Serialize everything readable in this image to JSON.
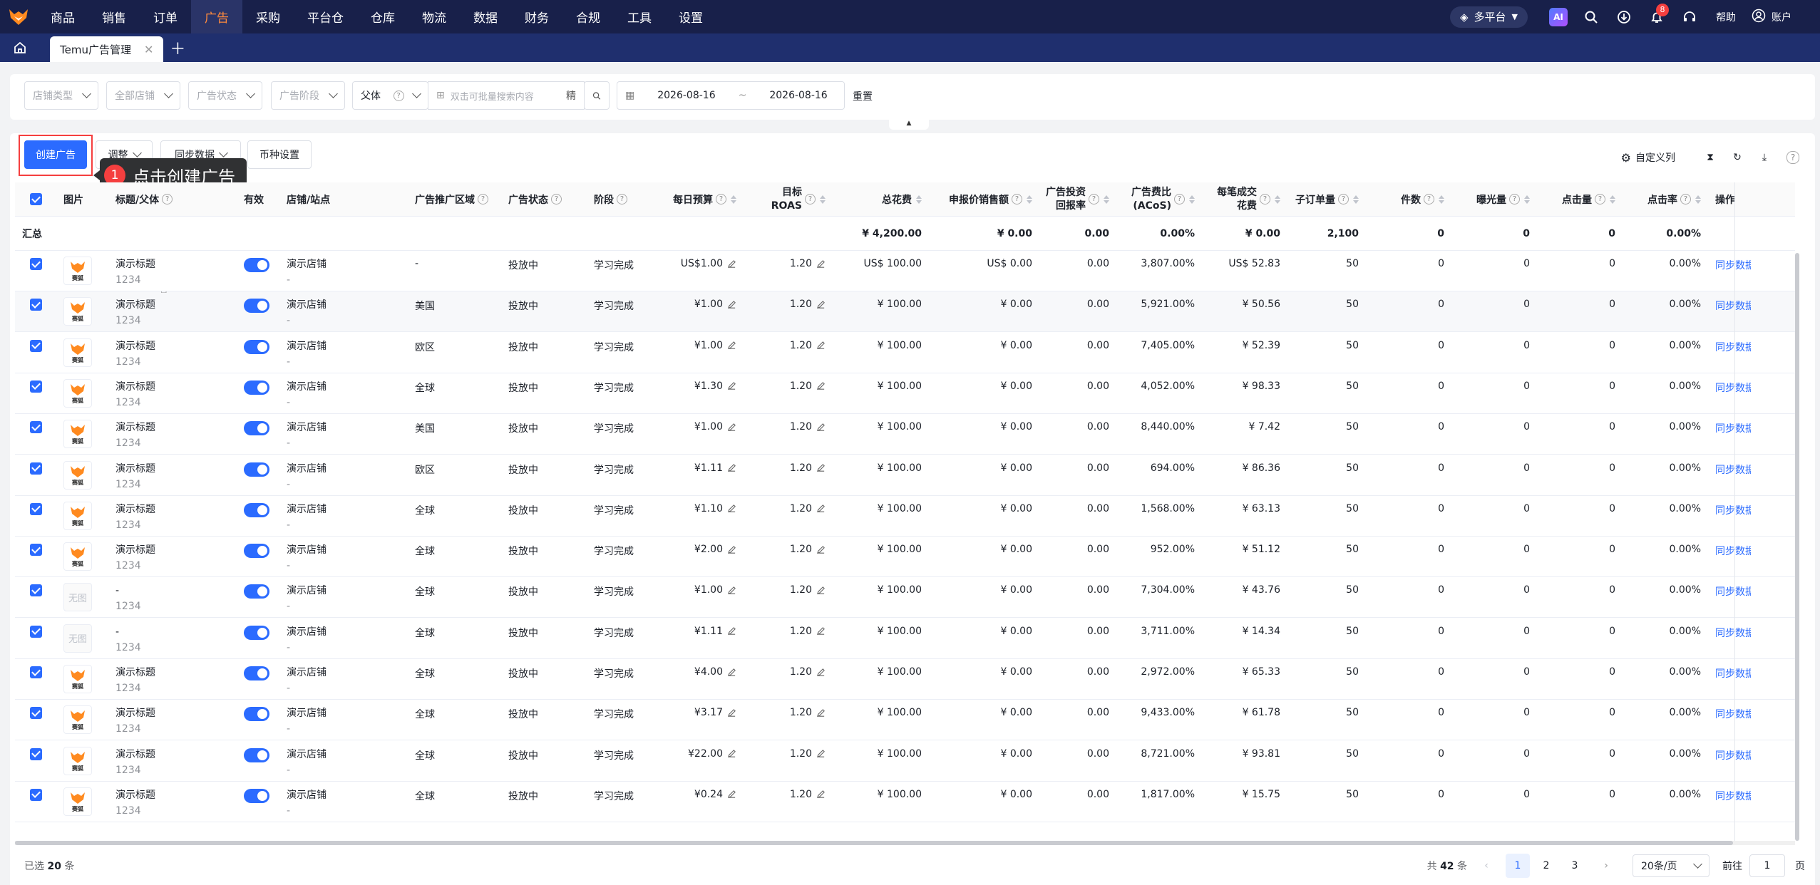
{
  "nav": {
    "items": [
      "商品",
      "销售",
      "订单",
      "广告",
      "采购",
      "平台仓",
      "仓库",
      "物流",
      "数据",
      "财务",
      "合规",
      "工具",
      "设置"
    ],
    "active_index": 3,
    "platform": "多平台",
    "notifications": "8",
    "help": "帮助",
    "account": "账户"
  },
  "tabs": {
    "current": "Temu广告管理"
  },
  "filters": {
    "shop_type": "店铺类型",
    "all_shops": "全部店铺",
    "ad_status": "广告状态",
    "ad_stage": "广告阶段",
    "parent": "父体",
    "search_placeholder": "双击可批量搜索内容",
    "exact": "精",
    "date_start": "2026-08-16",
    "date_sep": "~",
    "date_end": "2026-08-16",
    "reset": "重置"
  },
  "toolbar": {
    "create": "创建广告",
    "adjust": "调整",
    "sync": "同步数据",
    "currency": "币种设置",
    "custom_cols": "自定义列"
  },
  "tooltip": {
    "step": "1",
    "text": "点击创建广告"
  },
  "table": {
    "headers": {
      "image": "图片",
      "title": "标题/父体",
      "valid": "有效",
      "shop": "店铺/站点",
      "region": "广告推广区域",
      "status": "广告状态",
      "stage": "阶段",
      "budget": "每日预算",
      "roas_1": "目标",
      "roas_2": "ROAS",
      "spend": "总花费",
      "declared_sales": "申报价销售额",
      "roi_1": "广告投资",
      "roi_2": "回报率",
      "acos_1": "广告费比",
      "acos_2": "(ACoS)",
      "cpa_1": "每笔成交",
      "cpa_2": "花费",
      "sub_orders": "子订单量",
      "pieces": "件数",
      "impressions": "曝光量",
      "clicks": "点击量",
      "ctr": "点击率",
      "ops": "操作"
    },
    "summary": {
      "label": "汇总",
      "spend": "¥ 4,200.00",
      "sales": "¥ 0.00",
      "roi": "0.00",
      "acos": "0.00%",
      "cpa": "¥ 0.00",
      "sub_orders": "2,100",
      "pieces": "0",
      "impressions": "0",
      "clicks": "0",
      "ctr": "0.00%"
    },
    "rows": [
      {
        "img": "logo",
        "title": "演示标题",
        "sku": "1234",
        "shop": "演示店铺",
        "site": "-",
        "region": "-",
        "status": "投放中",
        "stage": "学习完成",
        "budget": "US$1.00",
        "roas": "1.20",
        "spend": "US$ 100.00",
        "sales": "US$ 0.00",
        "roi": "0.00",
        "acos": "3,807.00%",
        "cpa": "US$ 52.83",
        "sub_orders": "50",
        "pieces": "0",
        "impressions": "0",
        "clicks": "0",
        "ctr": "0.00%",
        "op": "同步数据"
      },
      {
        "img": "logo",
        "title": "演示标题",
        "sku": "1234",
        "shop": "演示店铺",
        "site": "-",
        "region": "美国",
        "status": "投放中",
        "stage": "学习完成",
        "budget": "¥1.00",
        "roas": "1.20",
        "spend": "¥ 100.00",
        "sales": "¥ 0.00",
        "roi": "0.00",
        "acos": "5,921.00%",
        "cpa": "¥ 50.56",
        "sub_orders": "50",
        "pieces": "0",
        "impressions": "0",
        "clicks": "0",
        "ctr": "0.00%",
        "op": "同步数据"
      },
      {
        "img": "logo",
        "title": "演示标题",
        "sku": "1234",
        "shop": "演示店铺",
        "site": "-",
        "region": "欧区",
        "status": "投放中",
        "stage": "学习完成",
        "budget": "¥1.00",
        "roas": "1.20",
        "spend": "¥ 100.00",
        "sales": "¥ 0.00",
        "roi": "0.00",
        "acos": "7,405.00%",
        "cpa": "¥ 52.39",
        "sub_orders": "50",
        "pieces": "0",
        "impressions": "0",
        "clicks": "0",
        "ctr": "0.00%",
        "op": "同步数据"
      },
      {
        "img": "logo",
        "title": "演示标题",
        "sku": "1234",
        "shop": "演示店铺",
        "site": "-",
        "region": "全球",
        "status": "投放中",
        "stage": "学习完成",
        "budget": "¥1.30",
        "roas": "1.20",
        "spend": "¥ 100.00",
        "sales": "¥ 0.00",
        "roi": "0.00",
        "acos": "4,052.00%",
        "cpa": "¥ 98.33",
        "sub_orders": "50",
        "pieces": "0",
        "impressions": "0",
        "clicks": "0",
        "ctr": "0.00%",
        "op": "同步数据"
      },
      {
        "img": "logo",
        "title": "演示标题",
        "sku": "1234",
        "shop": "演示店铺",
        "site": "-",
        "region": "美国",
        "status": "投放中",
        "stage": "学习完成",
        "budget": "¥1.00",
        "roas": "1.20",
        "spend": "¥ 100.00",
        "sales": "¥ 0.00",
        "roi": "0.00",
        "acos": "8,440.00%",
        "cpa": "¥ 7.42",
        "sub_orders": "50",
        "pieces": "0",
        "impressions": "0",
        "clicks": "0",
        "ctr": "0.00%",
        "op": "同步数据"
      },
      {
        "img": "logo",
        "title": "演示标题",
        "sku": "1234",
        "shop": "演示店铺",
        "site": "-",
        "region": "欧区",
        "status": "投放中",
        "stage": "学习完成",
        "budget": "¥1.11",
        "roas": "1.20",
        "spend": "¥ 100.00",
        "sales": "¥ 0.00",
        "roi": "0.00",
        "acos": "694.00%",
        "cpa": "¥ 86.36",
        "sub_orders": "50",
        "pieces": "0",
        "impressions": "0",
        "clicks": "0",
        "ctr": "0.00%",
        "op": "同步数据"
      },
      {
        "img": "logo",
        "title": "演示标题",
        "sku": "1234",
        "shop": "演示店铺",
        "site": "-",
        "region": "全球",
        "status": "投放中",
        "stage": "学习完成",
        "budget": "¥1.10",
        "roas": "1.20",
        "spend": "¥ 100.00",
        "sales": "¥ 0.00",
        "roi": "0.00",
        "acos": "1,568.00%",
        "cpa": "¥ 63.13",
        "sub_orders": "50",
        "pieces": "0",
        "impressions": "0",
        "clicks": "0",
        "ctr": "0.00%",
        "op": "同步数据"
      },
      {
        "img": "logo",
        "title": "演示标题",
        "sku": "1234",
        "shop": "演示店铺",
        "site": "-",
        "region": "全球",
        "status": "投放中",
        "stage": "学习完成",
        "budget": "¥2.00",
        "roas": "1.20",
        "spend": "¥ 100.00",
        "sales": "¥ 0.00",
        "roi": "0.00",
        "acos": "952.00%",
        "cpa": "¥ 51.12",
        "sub_orders": "50",
        "pieces": "0",
        "impressions": "0",
        "clicks": "0",
        "ctr": "0.00%",
        "op": "同步数据"
      },
      {
        "img": "none",
        "title": "-",
        "sku": "1234",
        "shop": "演示店铺",
        "site": "-",
        "region": "全球",
        "status": "投放中",
        "stage": "学习完成",
        "budget": "¥1.00",
        "roas": "1.20",
        "spend": "¥ 100.00",
        "sales": "¥ 0.00",
        "roi": "0.00",
        "acos": "7,304.00%",
        "cpa": "¥ 43.76",
        "sub_orders": "50",
        "pieces": "0",
        "impressions": "0",
        "clicks": "0",
        "ctr": "0.00%",
        "op": "同步数据"
      },
      {
        "img": "none",
        "title": "-",
        "sku": "1234",
        "shop": "演示店铺",
        "site": "-",
        "region": "全球",
        "status": "投放中",
        "stage": "学习完成",
        "budget": "¥1.11",
        "roas": "1.20",
        "spend": "¥ 100.00",
        "sales": "¥ 0.00",
        "roi": "0.00",
        "acos": "3,711.00%",
        "cpa": "¥ 14.34",
        "sub_orders": "50",
        "pieces": "0",
        "impressions": "0",
        "clicks": "0",
        "ctr": "0.00%",
        "op": "同步数据"
      },
      {
        "img": "logo",
        "title": "演示标题",
        "sku": "1234",
        "shop": "演示店铺",
        "site": "-",
        "region": "全球",
        "status": "投放中",
        "stage": "学习完成",
        "budget": "¥4.00",
        "roas": "1.20",
        "spend": "¥ 100.00",
        "sales": "¥ 0.00",
        "roi": "0.00",
        "acos": "2,972.00%",
        "cpa": "¥ 65.33",
        "sub_orders": "50",
        "pieces": "0",
        "impressions": "0",
        "clicks": "0",
        "ctr": "0.00%",
        "op": "同步数据"
      },
      {
        "img": "logo",
        "title": "演示标题",
        "sku": "1234",
        "shop": "演示店铺",
        "site": "-",
        "region": "全球",
        "status": "投放中",
        "stage": "学习完成",
        "budget": "¥3.17",
        "roas": "1.20",
        "spend": "¥ 100.00",
        "sales": "¥ 0.00",
        "roi": "0.00",
        "acos": "9,433.00%",
        "cpa": "¥ 61.78",
        "sub_orders": "50",
        "pieces": "0",
        "impressions": "0",
        "clicks": "0",
        "ctr": "0.00%",
        "op": "同步数据"
      },
      {
        "img": "logo",
        "title": "演示标题",
        "sku": "1234",
        "shop": "演示店铺",
        "site": "-",
        "region": "全球",
        "status": "投放中",
        "stage": "学习完成",
        "budget": "¥22.00",
        "roas": "1.20",
        "spend": "¥ 100.00",
        "sales": "¥ 0.00",
        "roi": "0.00",
        "acos": "8,721.00%",
        "cpa": "¥ 93.81",
        "sub_orders": "50",
        "pieces": "0",
        "impressions": "0",
        "clicks": "0",
        "ctr": "0.00%",
        "op": "同步数据"
      },
      {
        "img": "logo",
        "title": "演示标题",
        "sku": "1234",
        "shop": "演示店铺",
        "site": "-",
        "region": "全球",
        "status": "投放中",
        "stage": "学习完成",
        "budget": "¥0.24",
        "roas": "1.20",
        "spend": "¥ 100.00",
        "sales": "¥ 0.00",
        "roi": "0.00",
        "acos": "1,817.00%",
        "cpa": "¥ 15.75",
        "sub_orders": "50",
        "pieces": "0",
        "impressions": "0",
        "clicks": "0",
        "ctr": "0.00%",
        "op": "同步数据"
      }
    ]
  },
  "footer": {
    "selected_label": "已选",
    "selected_count": "20",
    "selected_unit": "条",
    "total_prefix": "共",
    "total": "42",
    "total_unit": "条",
    "pages": [
      "1",
      "2",
      "3"
    ],
    "page_size": "20条/页",
    "goto": "前往",
    "goto_value": "1",
    "page_unit": "页"
  }
}
